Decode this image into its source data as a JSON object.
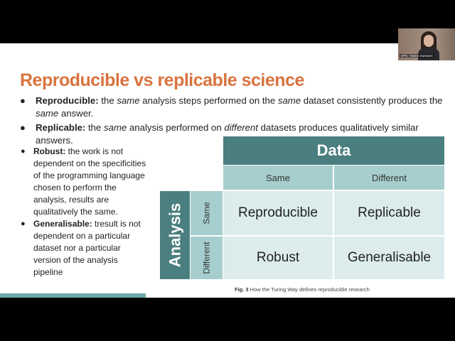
{
  "slide": {
    "title": "Reproducible vs replicable science",
    "top_bullets": [
      {
        "term": "Reproducible:",
        "parts": [
          " the ",
          "same",
          " analysis steps performed on the ",
          "same",
          " dataset consistently produces the ",
          "same",
          " answer."
        ]
      },
      {
        "term": "Replicable:",
        "parts": [
          " the ",
          "same",
          " analysis performed on ",
          "different",
          " datasets produces qualitatively similar answers."
        ]
      }
    ],
    "left_bullets": [
      {
        "term": "Robust:",
        "text": " the work is not dependent on the specificities of the programming language chosen to perform the analysis, results are qualitatively the same."
      },
      {
        "term": "Generalisable:",
        "text": " tresult is not dependent on a particular dataset nor a particular version of the analysis pipeline"
      }
    ],
    "table": {
      "data_header": "Data",
      "analysis_header": "Analysis",
      "columns": [
        "Same",
        "Different"
      ],
      "rows": [
        "Same",
        "Different"
      ],
      "cells": [
        [
          "Reproducible",
          "Replicable"
        ],
        [
          "Robust",
          "Generalisable"
        ]
      ]
    },
    "caption": {
      "fig": "Fig. 3",
      "text": " How the Turing Way defines reproducible research"
    }
  },
  "webcam": {
    "label": "HPS - Name Surname"
  },
  "colors": {
    "title": "#d9733f",
    "teal_dark": "#4b7f7f",
    "teal_mid": "#a7cece",
    "teal_light": "#dcecec"
  }
}
